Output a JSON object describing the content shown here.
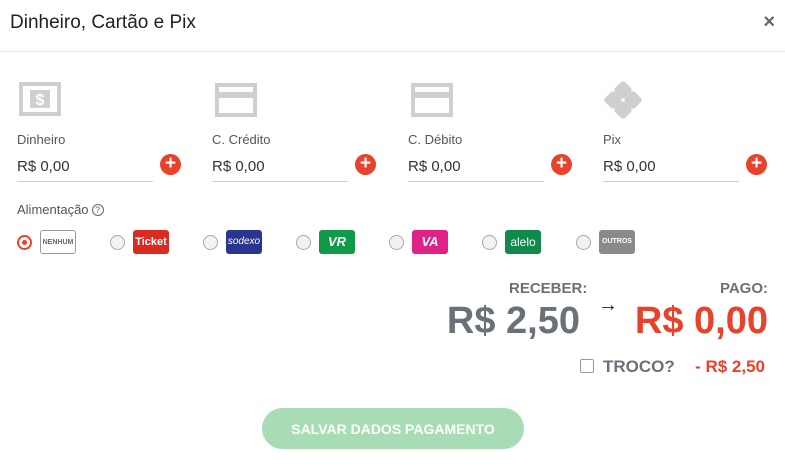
{
  "dialog": {
    "title": "Dinheiro, Cartão e Pix",
    "close_label": "×"
  },
  "methods": [
    {
      "icon": "cash-icon",
      "label": "Dinheiro",
      "value": "R$ 0,00"
    },
    {
      "icon": "credit-card-icon",
      "label": "C. Crédito",
      "value": "R$ 0,00"
    },
    {
      "icon": "debit-card-icon",
      "label": "C. Débito",
      "value": "R$ 0,00"
    },
    {
      "icon": "pix-icon",
      "label": "Pix",
      "value": "R$ 0,00"
    }
  ],
  "add_label": "+",
  "alimentacao": {
    "label": "Alimentação",
    "help_icon": "?",
    "options": [
      {
        "name": "NENHUM",
        "selected": true,
        "color": "#ffffff"
      },
      {
        "name": "Ticket",
        "selected": false,
        "color": "#d92b22"
      },
      {
        "name": "sodexo",
        "selected": false,
        "color": "#2a3590"
      },
      {
        "name": "VR",
        "selected": false,
        "color": "#0f9a48"
      },
      {
        "name": "VA",
        "selected": false,
        "color": "#e0218a"
      },
      {
        "name": "alelo",
        "selected": false,
        "color": "#0f8a4a"
      },
      {
        "name": "OUTROS",
        "selected": false,
        "color": "#8a8a8a"
      }
    ]
  },
  "summary": {
    "receber_label": "RECEBER:",
    "receber_value": "R$ 2,50",
    "arrow": "→",
    "pago_label": "PAGO:",
    "pago_value": "R$ 0,00",
    "troco_label": "TROCO?",
    "troco_value": "- R$ 2,50",
    "troco_checked": false
  },
  "save_button": "SALVAR DADOS PAGAMENTO",
  "colors": {
    "accent_red": "#e8412c",
    "button_green": "#a8dcb5",
    "muted_text": "#6b7178"
  }
}
